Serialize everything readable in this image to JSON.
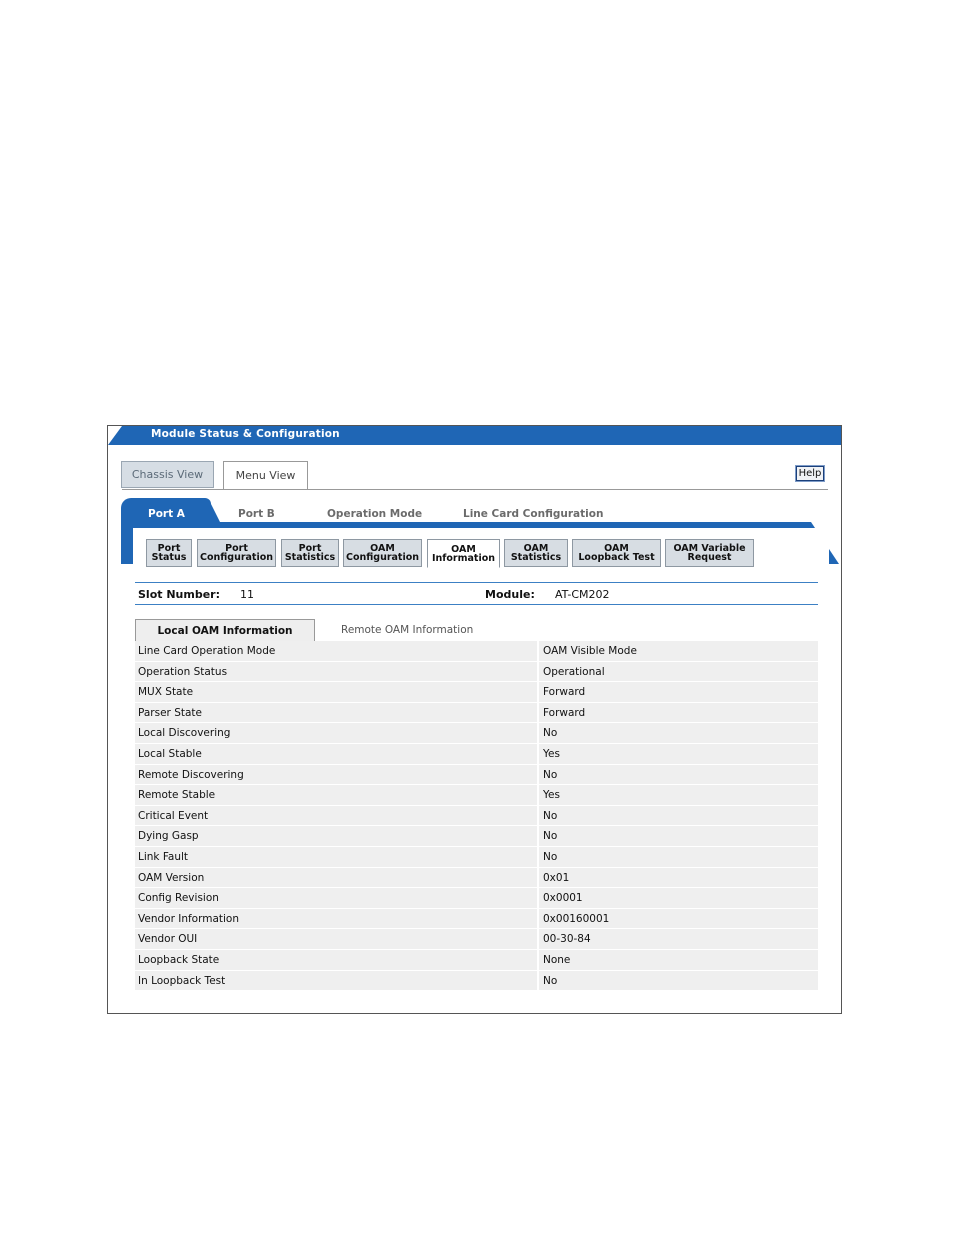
{
  "window": {
    "title": "Module Status & Configuration"
  },
  "view_tabs": [
    {
      "label": "Chassis View"
    },
    {
      "label": "Menu View"
    }
  ],
  "help_label": "Help",
  "port_tabs": [
    {
      "label": "Port A"
    },
    {
      "label": "Port B"
    },
    {
      "label": "Operation Mode"
    },
    {
      "label": "Line Card Configuration"
    }
  ],
  "sub_tabs": [
    {
      "line1": "Port",
      "line2": "Status"
    },
    {
      "line1": "Port",
      "line2": "Configuration"
    },
    {
      "line1": "Port",
      "line2": "Statistics"
    },
    {
      "line1": "OAM",
      "line2": "Configuration"
    },
    {
      "line1": "OAM",
      "line2": "Information"
    },
    {
      "line1": "OAM",
      "line2": "Statistics"
    },
    {
      "line1": "OAM",
      "line2": "Loopback Test"
    },
    {
      "line1": "OAM Variable",
      "line2": "Request"
    }
  ],
  "slot": {
    "label": "Slot Number:",
    "value": "11"
  },
  "module": {
    "label": "Module:",
    "value": "AT-CM202"
  },
  "info_tabs": [
    {
      "label": "Local OAM Information"
    },
    {
      "label": "Remote OAM Information"
    }
  ],
  "rows": [
    {
      "k": "Line Card Operation Mode",
      "v": "OAM Visible Mode"
    },
    {
      "k": "Operation Status",
      "v": "Operational"
    },
    {
      "k": "MUX State",
      "v": "Forward"
    },
    {
      "k": "Parser State",
      "v": "Forward"
    },
    {
      "k": "Local Discovering",
      "v": "No"
    },
    {
      "k": "Local Stable",
      "v": "Yes"
    },
    {
      "k": "Remote Discovering",
      "v": "No"
    },
    {
      "k": "Remote Stable",
      "v": "Yes"
    },
    {
      "k": "Critical Event",
      "v": "No"
    },
    {
      "k": "Dying Gasp",
      "v": "No"
    },
    {
      "k": "Link Fault",
      "v": "No"
    },
    {
      "k": "OAM Version",
      "v": "0x01"
    },
    {
      "k": "Config Revision",
      "v": "0x0001"
    },
    {
      "k": "Vendor Information",
      "v": "0x00160001"
    },
    {
      "k": "Vendor OUI",
      "v": "00-30-84"
    },
    {
      "k": "Loopback State",
      "v": "None"
    },
    {
      "k": "In Loopback Test",
      "v": "No"
    }
  ],
  "colors": {
    "accent": "#1f66b5",
    "row_bg": "#efefef",
    "tab_bg": "#d7dde3"
  }
}
